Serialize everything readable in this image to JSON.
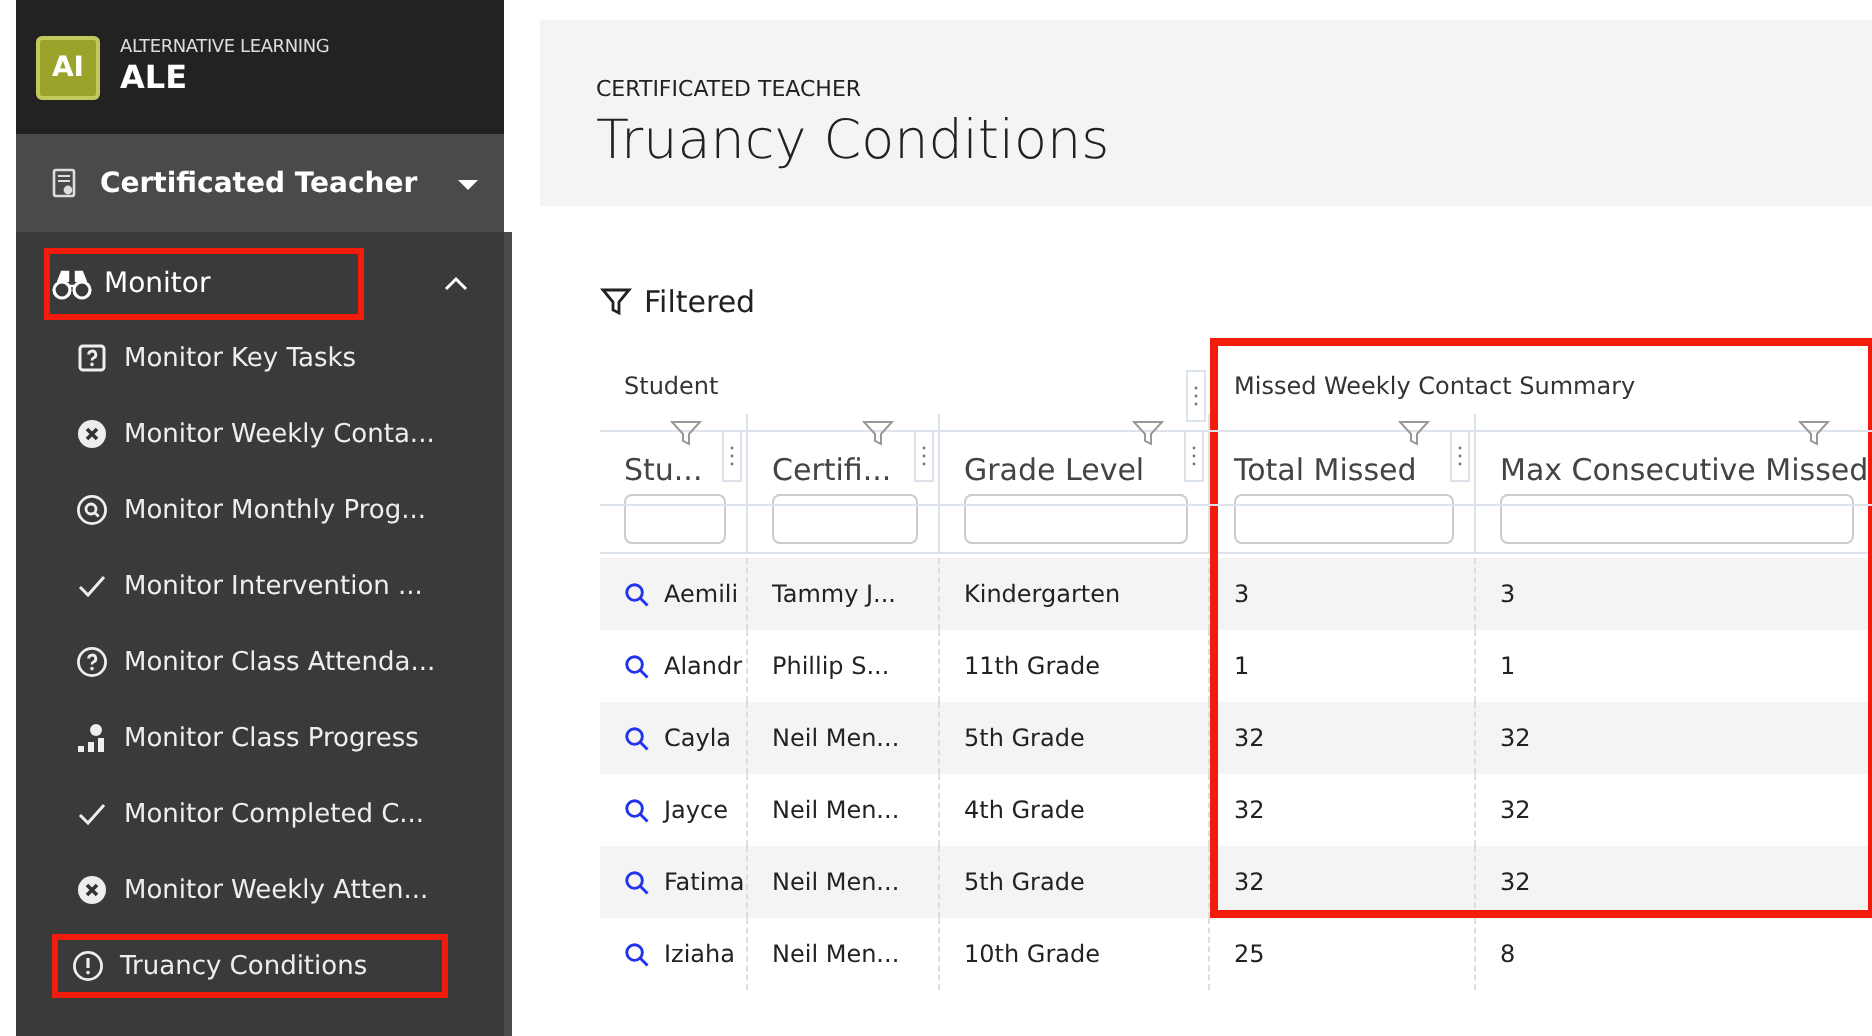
{
  "app": {
    "logo": "AI",
    "subtitle": "ALTERNATIVE LEARNING",
    "name": "ALE"
  },
  "role": {
    "label": "Certificated Teacher"
  },
  "nav": {
    "label": "Monitor",
    "expanded": true,
    "highlighted": true,
    "children": [
      {
        "label": "Monitor Key Tasks",
        "kind": "tasks",
        "highlighted": false
      },
      {
        "label": "Monitor Weekly Conta...",
        "kind": "cancel",
        "highlighted": false
      },
      {
        "label": "Monitor Monthly Prog...",
        "kind": "search",
        "highlighted": false
      },
      {
        "label": "Monitor Intervention ...",
        "kind": "check",
        "highlighted": false
      },
      {
        "label": "Monitor Class Attenda...",
        "kind": "help",
        "highlighted": false
      },
      {
        "label": "Monitor Class Progress",
        "kind": "chart",
        "highlighted": false
      },
      {
        "label": "Monitor Completed C...",
        "kind": "check",
        "highlighted": false
      },
      {
        "label": "Monitor Weekly Atten...",
        "kind": "cancel",
        "highlighted": false
      },
      {
        "label": "Truancy Conditions",
        "kind": "alert",
        "highlighted": true
      }
    ]
  },
  "page": {
    "eyebrow": "CERTIFICATED TEACHER",
    "title": "Truancy Conditions"
  },
  "filter": {
    "label": "Filtered"
  },
  "table": {
    "groups": [
      {
        "label": "Student",
        "highlighted": false
      },
      {
        "label": "Missed Weekly Contact Summary",
        "highlighted": true
      }
    ],
    "columns": [
      "Stu...",
      "Certifi...",
      "Grade Level",
      "Total Missed",
      "Max Consecutive Missed"
    ],
    "rows": [
      [
        "Aemili",
        "Tammy J...",
        "Kindergarten",
        "3",
        "3"
      ],
      [
        "Alandr",
        "Phillip S...",
        "11th Grade",
        "1",
        "1"
      ],
      [
        "Cayla",
        "Neil Men...",
        "5th Grade",
        "32",
        "32"
      ],
      [
        "Jayce",
        "Neil Men...",
        "4th Grade",
        "32",
        "32"
      ],
      [
        "Fatima",
        "Neil Men...",
        "5th Grade",
        "32",
        "32"
      ],
      [
        "Iziaha",
        "Neil Men...",
        "10th Grade",
        "25",
        "8"
      ]
    ]
  }
}
